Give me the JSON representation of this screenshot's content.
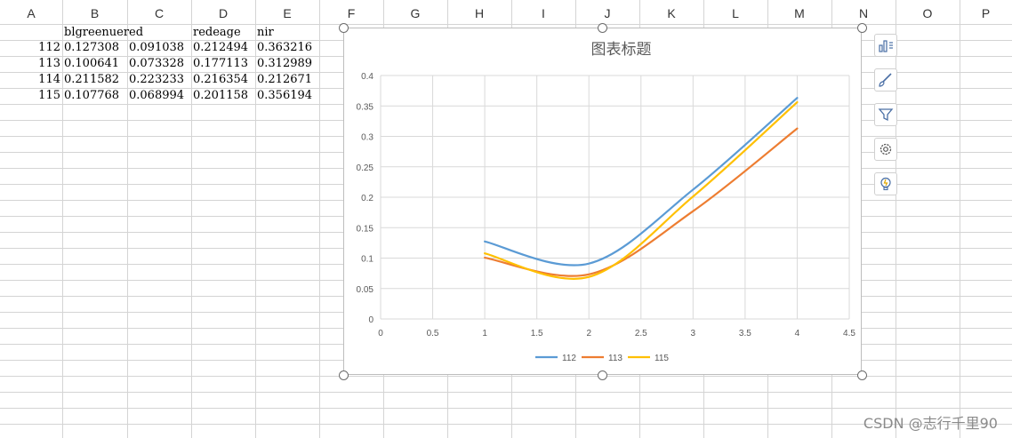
{
  "spreadsheet": {
    "column_headers": [
      "A",
      "B",
      "C",
      "D",
      "E",
      "F",
      "G",
      "H",
      "I",
      "J",
      "K",
      "L",
      "M",
      "N",
      "O",
      "P"
    ],
    "header_row": [
      "",
      "blgreenuered",
      "",
      "redeage",
      "nir"
    ],
    "rows": [
      {
        "label": "112",
        "cells": [
          "0.127308",
          "0.091038",
          "0.212494",
          "0.363216"
        ]
      },
      {
        "label": "113",
        "cells": [
          "0.100641",
          "0.073328",
          "0.177113",
          "0.312989"
        ]
      },
      {
        "label": "114",
        "cells": [
          "0.211582",
          "0.223233",
          "0.216354",
          "0.212671"
        ]
      },
      {
        "label": "115",
        "cells": [
          "0.107768",
          "0.068994",
          "0.201158",
          "0.356194"
        ]
      }
    ]
  },
  "chart_data": {
    "type": "line",
    "smooth": true,
    "title": "图表标题",
    "xlabel": "",
    "ylabel": "",
    "xlim": [
      0,
      4.5
    ],
    "ylim": [
      0,
      0.4
    ],
    "x_ticks": [
      "0",
      "0.5",
      "1",
      "1.5",
      "2",
      "2.5",
      "3",
      "3.5",
      "4",
      "4.5"
    ],
    "y_ticks": [
      "0",
      "0.05",
      "0.1",
      "0.15",
      "0.2",
      "0.25",
      "0.3",
      "0.35",
      "0.4"
    ],
    "x": [
      1,
      2,
      3,
      4
    ],
    "grid": true,
    "legend_position": "bottom",
    "series": [
      {
        "name": "112",
        "color": "#5b9bd5",
        "values": [
          0.127308,
          0.091038,
          0.212494,
          0.363216
        ]
      },
      {
        "name": "113",
        "color": "#ed7d31",
        "values": [
          0.100641,
          0.073328,
          0.177113,
          0.312989
        ]
      },
      {
        "name": "115",
        "color": "#ffc000",
        "values": [
          0.107768,
          0.068994,
          0.201158,
          0.356194
        ]
      }
    ]
  },
  "side_buttons": [
    {
      "icon": "chart-elements-icon"
    },
    {
      "icon": "chart-style-brush-icon"
    },
    {
      "icon": "chart-filter-icon"
    },
    {
      "icon": "chart-settings-gear-icon"
    },
    {
      "icon": "lightbulb-icon"
    }
  ],
  "watermark": "CSDN @志行千里90"
}
